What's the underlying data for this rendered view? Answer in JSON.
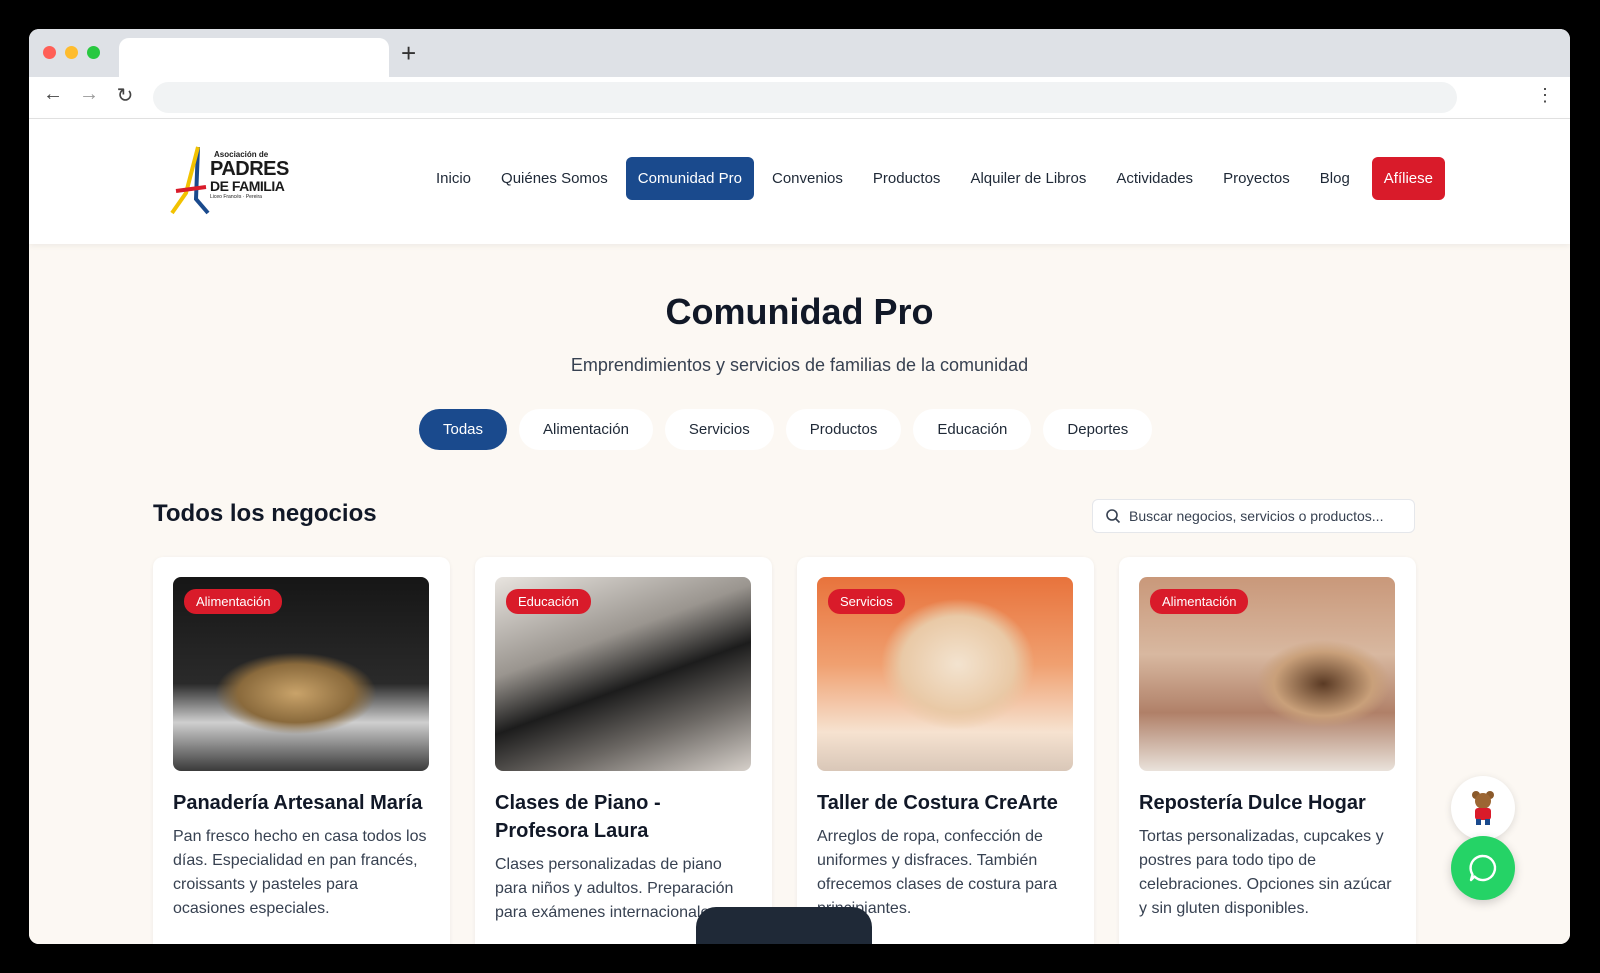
{
  "browser": {
    "new_tab_symbol": "+",
    "back_icon": "←",
    "forward_icon": "→",
    "reload_icon": "↻",
    "menu_icon": "⋮"
  },
  "header": {
    "logo": {
      "line1": "Asociación de",
      "line2": "PADRES",
      "line3": "DE FAMILIA",
      "line4": "Liceo Francés · Pereira"
    },
    "nav": [
      {
        "label": "Inicio"
      },
      {
        "label": "Quiénes Somos"
      },
      {
        "label": "Comunidad Pro",
        "active": true
      },
      {
        "label": "Convenios"
      },
      {
        "label": "Productos"
      },
      {
        "label": "Alquiler de Libros"
      },
      {
        "label": "Actividades"
      },
      {
        "label": "Proyectos"
      },
      {
        "label": "Blog"
      }
    ],
    "cta_label": "Afíliese"
  },
  "hero": {
    "title": "Comunidad Pro",
    "subtitle": "Emprendimientos y servicios de familias de la comunidad"
  },
  "filters": [
    "Todas",
    "Alimentación",
    "Servicios",
    "Productos",
    "Educación",
    "Deportes"
  ],
  "active_filter": "Todas",
  "section": {
    "title": "Todos los negocios",
    "search_placeholder": "Buscar negocios, servicios o productos..."
  },
  "cards": [
    {
      "category": "Alimentación",
      "title": "Panadería Artesanal María",
      "description": "Pan fresco hecho en casa todos los días. Especialidad en pan francés, croissants y pasteles para ocasiones especiales."
    },
    {
      "category": "Educación",
      "title": "Clases de Piano - Profesora Laura",
      "description": "Clases personalizadas de piano para niños y adultos. Preparación para exámenes internacionales."
    },
    {
      "category": "Servicios",
      "title": "Taller de Costura CreArte",
      "description": "Arreglos de ropa, confección de uniformes y disfraces. También ofrecemos clases de costura para principiantes."
    },
    {
      "category": "Alimentación",
      "title": "Repostería Dulce Hogar",
      "description": "Tortas personalizadas, cupcakes y postres para todo tipo de celebraciones. Opciones sin azúcar y sin gluten disponibles."
    }
  ],
  "colors": {
    "primary": "#1a4a8d",
    "accent": "#d91b2a",
    "background": "#fcf8f3",
    "whatsapp": "#25d366"
  }
}
